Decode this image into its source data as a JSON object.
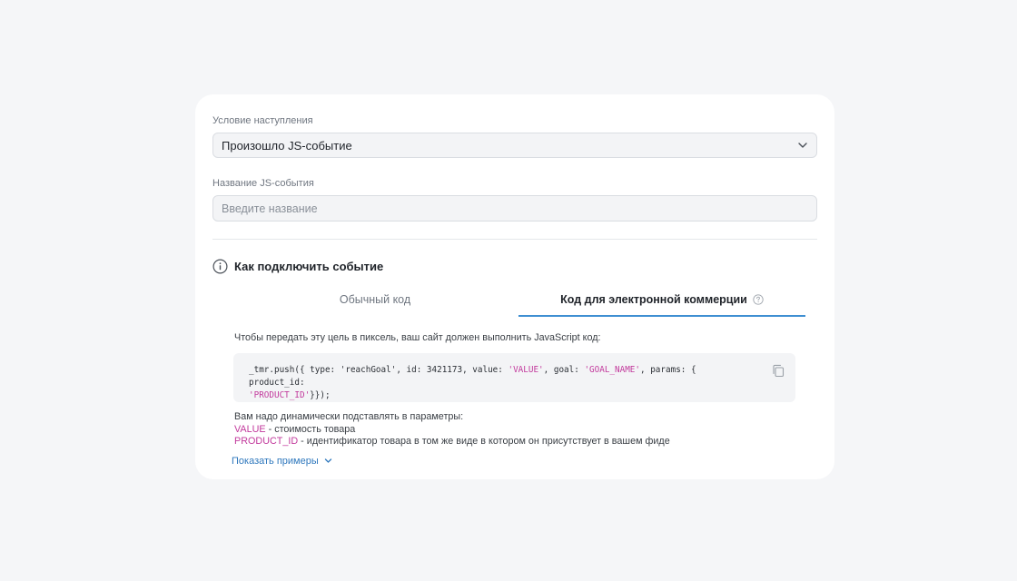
{
  "condition": {
    "label": "Условие наступления",
    "value": "Произошло JS-событие",
    "icon": "chevron-down-icon"
  },
  "event_name": {
    "label": "Название JS-события",
    "value": "",
    "placeholder": "Введите название"
  },
  "howto": {
    "icon": "info-icon",
    "title": "Как подключить событие"
  },
  "tabs": [
    {
      "label": "Обычный код",
      "active": false
    },
    {
      "label": "Код для электронной коммерции",
      "active": true,
      "icon": "help-icon"
    }
  ],
  "instructions": "Чтобы передать эту цель в пиксель, ваш сайт должен выполнить JavaScript код:",
  "code": {
    "part1": "_tmr.push({ type: 'reachGoal', id: 3421173, value: ",
    "value_str": "'VALUE'",
    "part2": ", goal: ",
    "goal_str": "'GOAL_NAME'",
    "part3": ", params: { product_id:",
    "product_str": "'PRODUCT_ID'",
    "part4": "}});",
    "copy_icon": "copy-icon"
  },
  "params": {
    "intro": "Вам надо динамически подставлять в параметры:",
    "items": [
      {
        "key": "VALUE",
        "desc": " - стоимость товара"
      },
      {
        "key": "PRODUCT_ID",
        "desc": " - идентификатор товара в том же виде в котором он присутствует в вашем фиде"
      }
    ]
  },
  "show_examples": {
    "label": "Показать примеры",
    "icon": "chevron-down-icon"
  },
  "colors": {
    "accent": "#3f8fd2",
    "link": "#2f78bd",
    "code_string": "#c2399c",
    "page_bg": "#f5f6f8",
    "card_bg": "#ffffff"
  }
}
